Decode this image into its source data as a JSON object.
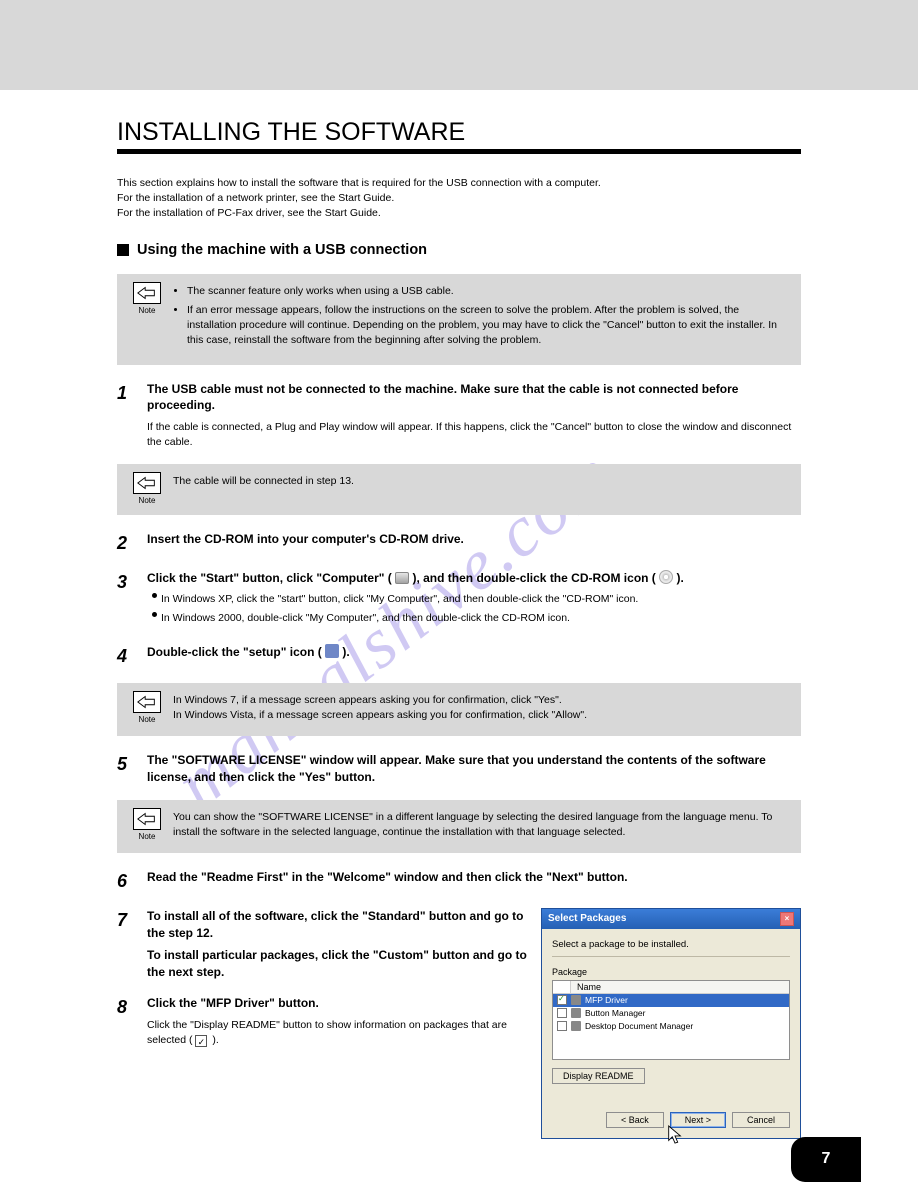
{
  "top_bar": {},
  "heading": "INSTALLING THE SOFTWARE",
  "intro": {
    "p1_seg1": "This section explains how to install the software that is required for the USB connection with a computer.",
    "p1_seg2": "For the installation of a network printer, see the Start Guide.",
    "p1_seg3": "For the installation of PC-Fax driver, see the Start Guide."
  },
  "note1": {
    "label": "Note",
    "items": [
      "The scanner feature only works when using a USB cable.",
      "If an error message appears, follow the instructions on the screen to solve the problem. After the problem is solved, the installation procedure will continue. Depending on the problem, you may have to click the \"Cancel\" button to exit the installer. In this case, reinstall the software from the beginning after solving the problem."
    ]
  },
  "sub_heading": "Using the machine with a USB connection",
  "steps": {
    "s1": {
      "n": "1",
      "main": "The USB cable must not be connected to the machine. Make sure that the cable is not connected before proceeding.",
      "sub": "If the cable is connected, a Plug and Play window will appear. If this happens, click the \"Cancel\" button to close the window and disconnect the cable."
    },
    "s2": {
      "n": "2",
      "main": "Insert the CD-ROM into your computer's CD-ROM drive."
    },
    "s3": {
      "n": "3",
      "seg1": "Click the \"Start\" button, click \"Computer\" ( ",
      "seg2": " ), and then double-click the CD-ROM icon ( ",
      "seg3": " ).",
      "bullets": [
        {
          "seg1": "In Windows XP, click the \"start\" button, click \"My Computer\", and then double-click the \"CD-ROM\" icon."
        },
        {
          "seg1": "In Windows 2000, double-click \"My Computer\", and then double-click the CD-ROM icon."
        }
      ]
    },
    "s4": {
      "n": "4",
      "seg1": "Double-click the \"setup\" icon ( ",
      "seg2": " )."
    },
    "s5": {
      "n": "5",
      "main": "The \"SOFTWARE LICENSE\" window will appear. Make sure that you understand the contents of the software license, and then click the \"Yes\" button."
    },
    "s6": {
      "n": "6",
      "main": "Read the \"Readme First\" in the \"Welcome\" window and then click the \"Next\" button."
    },
    "s7": {
      "n": "7",
      "main": "To install all of the software, click the \"Standard\" button and go to the step 12.",
      "main2": "To install particular packages, click the \"Custom\" button and go to the next step."
    },
    "s8": {
      "n": "8",
      "main": "Click the \"MFP Driver\" button.",
      "sub": "Click the \"Display README\" button to show information on packages that are selected.",
      "checkbox_label": " )."
    }
  },
  "note2": {
    "label": "Note",
    "text": "The cable will be connected in step 13."
  },
  "note3": {
    "label": "Note",
    "text_seg1": "In Windows 7, if a message screen appears asking you for confirmation, click \"Yes\".",
    "text_seg2": "In Windows Vista, if a message screen appears asking you for confirmation, click \"Allow\"."
  },
  "note4": {
    "label": "Note",
    "text": "You can show the \"SOFTWARE LICENSE\" in a different language by selecting the desired language from the language menu. To install the software in the selected language, continue the installation with that language selected."
  },
  "dialog": {
    "title": "Select Packages",
    "close": "×",
    "instr": "Select a package to be installed.",
    "pkg_label": "Package",
    "header_name": "Name",
    "items": [
      {
        "label": "MFP Driver",
        "checked": true,
        "selected": true
      },
      {
        "label": "Button Manager",
        "checked": false,
        "selected": false
      },
      {
        "label": "Desktop Document Manager",
        "checked": false,
        "selected": false
      }
    ],
    "readme_btn": "Display README",
    "back_btn": "< Back",
    "next_btn": "Next >",
    "cancel_btn": "Cancel"
  },
  "page_number": "7"
}
